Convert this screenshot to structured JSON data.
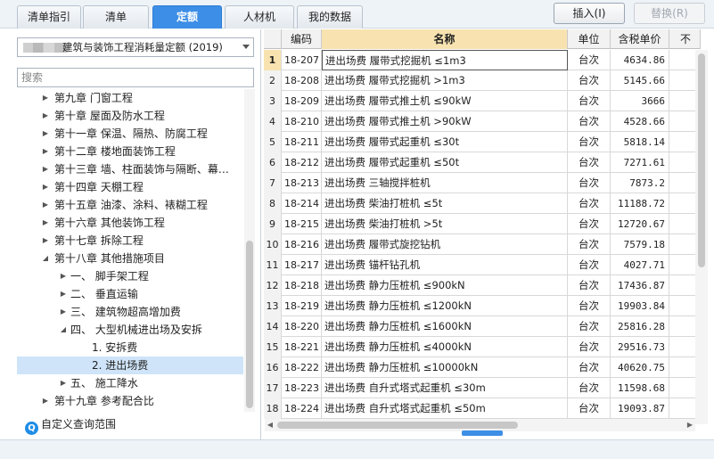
{
  "tabs": [
    {
      "label": "清单指引",
      "active": false
    },
    {
      "label": "清单",
      "active": false
    },
    {
      "label": "定额",
      "active": true
    },
    {
      "label": "人材机",
      "active": false
    },
    {
      "label": "我的数据",
      "active": false
    }
  ],
  "toolbar": {
    "insert_label": "插入(I)",
    "replace_label": "替换(R)"
  },
  "left": {
    "quota_library": "建筑与装饰工程消耗量定额 (2019)",
    "search_placeholder": "搜索",
    "custom_scope": "自定义查询范围",
    "tree": [
      {
        "label": "第九章  门窗工程",
        "level": 0,
        "arrow": "▶"
      },
      {
        "label": "第十章  屋面及防水工程",
        "level": 0,
        "arrow": "▶"
      },
      {
        "label": "第十一章  保温、隔热、防腐工程",
        "level": 0,
        "arrow": "▶"
      },
      {
        "label": "第十二章  楼地面装饰工程",
        "level": 0,
        "arrow": "▶"
      },
      {
        "label": "第十三章  墙、柱面装饰与隔断、幕…",
        "level": 0,
        "arrow": "▶"
      },
      {
        "label": "第十四章  天棚工程",
        "level": 0,
        "arrow": "▶"
      },
      {
        "label": "第十五章  油漆、涂料、裱糊工程",
        "level": 0,
        "arrow": "▶"
      },
      {
        "label": "第十六章  其他装饰工程",
        "level": 0,
        "arrow": "▶"
      },
      {
        "label": "第十七章  拆除工程",
        "level": 0,
        "arrow": "▶"
      },
      {
        "label": "第十八章  其他措施项目",
        "level": 0,
        "arrow": "◢"
      },
      {
        "label": "一、  脚手架工程",
        "level": 1,
        "arrow": "▶"
      },
      {
        "label": "二、  垂直运输",
        "level": 1,
        "arrow": "▶"
      },
      {
        "label": "三、  建筑物超高增加费",
        "level": 1,
        "arrow": "▶"
      },
      {
        "label": "四、  大型机械进出场及安拆",
        "level": 1,
        "arrow": "◢"
      },
      {
        "label": "1.  安拆费",
        "level": 2,
        "arrow": ""
      },
      {
        "label": "2.  进出场费",
        "level": 2,
        "arrow": "",
        "selected": true
      },
      {
        "label": "五、  施工降水",
        "level": 1,
        "arrow": "▶"
      },
      {
        "label": "第十九章  参考配合比",
        "level": 0,
        "arrow": "▶"
      }
    ]
  },
  "grid": {
    "headers": [
      "",
      "编码",
      "名称",
      "单位",
      "含税单价",
      "不"
    ],
    "rows": [
      {
        "idx": "1",
        "code": "18-207",
        "name": "进出场费  履带式挖掘机  ≤1m3",
        "unit": "台次",
        "price": "4634.86"
      },
      {
        "idx": "2",
        "code": "18-208",
        "name": "进出场费  履带式挖掘机  >1m3",
        "unit": "台次",
        "price": "5145.66"
      },
      {
        "idx": "3",
        "code": "18-209",
        "name": "进出场费  履带式推土机  ≤90kW",
        "unit": "台次",
        "price": "3666"
      },
      {
        "idx": "4",
        "code": "18-210",
        "name": "进出场费  履带式推土机  >90kW",
        "unit": "台次",
        "price": "4528.66"
      },
      {
        "idx": "5",
        "code": "18-211",
        "name": "进出场费  履带式起重机  ≤30t",
        "unit": "台次",
        "price": "5818.14"
      },
      {
        "idx": "6",
        "code": "18-212",
        "name": "进出场费  履带式起重机  ≤50t",
        "unit": "台次",
        "price": "7271.61"
      },
      {
        "idx": "7",
        "code": "18-213",
        "name": "进出场费  三轴搅拌桩机",
        "unit": "台次",
        "price": "7873.2"
      },
      {
        "idx": "8",
        "code": "18-214",
        "name": "进出场费  柴油打桩机  ≤5t",
        "unit": "台次",
        "price": "11188.72"
      },
      {
        "idx": "9",
        "code": "18-215",
        "name": "进出场费  柴油打桩机  >5t",
        "unit": "台次",
        "price": "12720.67"
      },
      {
        "idx": "10",
        "code": "18-216",
        "name": "进出场费  履带式旋挖钻机",
        "unit": "台次",
        "price": "7579.18"
      },
      {
        "idx": "11",
        "code": "18-217",
        "name": "进出场费  锚杆钻孔机",
        "unit": "台次",
        "price": "4027.71"
      },
      {
        "idx": "12",
        "code": "18-218",
        "name": "进出场费  静力压桩机  ≤900kN",
        "unit": "台次",
        "price": "17436.87"
      },
      {
        "idx": "13",
        "code": "18-219",
        "name": "进出场费  静力压桩机  ≤1200kN",
        "unit": "台次",
        "price": "19903.84"
      },
      {
        "idx": "14",
        "code": "18-220",
        "name": "进出场费  静力压桩机  ≤1600kN",
        "unit": "台次",
        "price": "25816.28"
      },
      {
        "idx": "15",
        "code": "18-221",
        "name": "进出场费  静力压桩机  ≤4000kN",
        "unit": "台次",
        "price": "29516.73"
      },
      {
        "idx": "16",
        "code": "18-222",
        "name": "进出场费  静力压桩机  ≤10000kN",
        "unit": "台次",
        "price": "40620.75"
      },
      {
        "idx": "17",
        "code": "18-223",
        "name": "进出场费  自升式塔式起重机  ≤30m",
        "unit": "台次",
        "price": "11598.68"
      },
      {
        "idx": "18",
        "code": "18-224",
        "name": "进出场费  自升式塔式起重机  ≤50m",
        "unit": "台次",
        "price": "19093.87"
      }
    ]
  },
  "colors": {
    "accent": "#3d8ee6",
    "header_highlight": "#f8e3b0",
    "selection": "#cfe4f8"
  }
}
